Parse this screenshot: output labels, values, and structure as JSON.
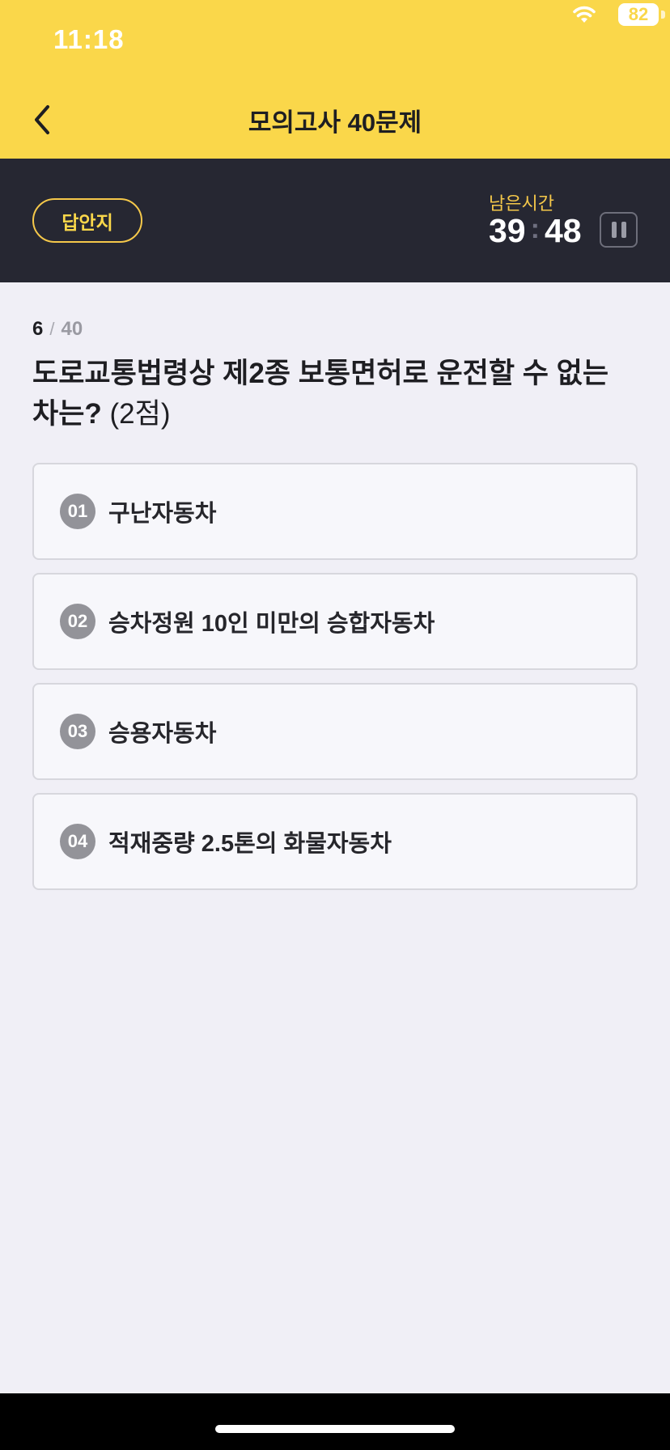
{
  "status": {
    "time": "11:18",
    "battery": "82",
    "wifi_icon": "wifi-icon",
    "battery_icon": "battery-icon"
  },
  "nav": {
    "title": "모의고사 40문제",
    "back_icon": "chevron-left-icon"
  },
  "timer": {
    "answer_sheet_label": "답안지",
    "remaining_label": "남은시간",
    "minutes": "39",
    "colon": ":",
    "seconds": "48",
    "pause_icon": "pause-icon"
  },
  "question": {
    "current": "6",
    "separator": "/",
    "total": "40",
    "text": "도로교통법령상 제2종 보통면허로 운전할 수 없는 차는?",
    "points": "(2점)"
  },
  "options": [
    {
      "num": "01",
      "text": "구난자동차"
    },
    {
      "num": "02",
      "text": "승차정원 10인 미만의 승합자동차"
    },
    {
      "num": "03",
      "text": "승용자동차"
    },
    {
      "num": "04",
      "text": "적재중량 2.5톤의 화물자동차"
    }
  ],
  "colors": {
    "accent": "#fad74a",
    "header_dark": "#262732",
    "background": "#f0eff6",
    "option_badge": "#939399"
  }
}
